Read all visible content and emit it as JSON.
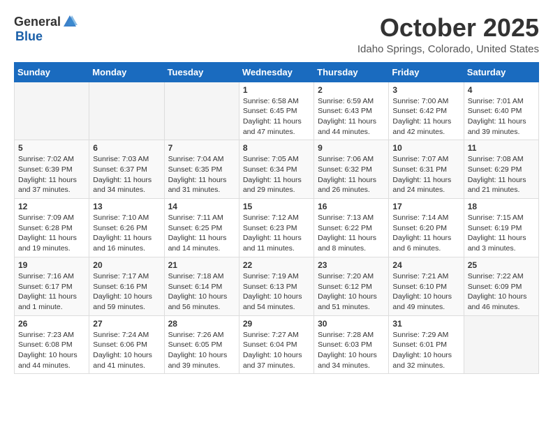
{
  "header": {
    "logo_general": "General",
    "logo_blue": "Blue",
    "title": "October 2025",
    "location": "Idaho Springs, Colorado, United States"
  },
  "columns": [
    "Sunday",
    "Monday",
    "Tuesday",
    "Wednesday",
    "Thursday",
    "Friday",
    "Saturday"
  ],
  "weeks": [
    [
      {
        "day": "",
        "info": ""
      },
      {
        "day": "",
        "info": ""
      },
      {
        "day": "",
        "info": ""
      },
      {
        "day": "1",
        "info": "Sunrise: 6:58 AM\nSunset: 6:45 PM\nDaylight: 11 hours and 47 minutes."
      },
      {
        "day": "2",
        "info": "Sunrise: 6:59 AM\nSunset: 6:43 PM\nDaylight: 11 hours and 44 minutes."
      },
      {
        "day": "3",
        "info": "Sunrise: 7:00 AM\nSunset: 6:42 PM\nDaylight: 11 hours and 42 minutes."
      },
      {
        "day": "4",
        "info": "Sunrise: 7:01 AM\nSunset: 6:40 PM\nDaylight: 11 hours and 39 minutes."
      }
    ],
    [
      {
        "day": "5",
        "info": "Sunrise: 7:02 AM\nSunset: 6:39 PM\nDaylight: 11 hours and 37 minutes."
      },
      {
        "day": "6",
        "info": "Sunrise: 7:03 AM\nSunset: 6:37 PM\nDaylight: 11 hours and 34 minutes."
      },
      {
        "day": "7",
        "info": "Sunrise: 7:04 AM\nSunset: 6:35 PM\nDaylight: 11 hours and 31 minutes."
      },
      {
        "day": "8",
        "info": "Sunrise: 7:05 AM\nSunset: 6:34 PM\nDaylight: 11 hours and 29 minutes."
      },
      {
        "day": "9",
        "info": "Sunrise: 7:06 AM\nSunset: 6:32 PM\nDaylight: 11 hours and 26 minutes."
      },
      {
        "day": "10",
        "info": "Sunrise: 7:07 AM\nSunset: 6:31 PM\nDaylight: 11 hours and 24 minutes."
      },
      {
        "day": "11",
        "info": "Sunrise: 7:08 AM\nSunset: 6:29 PM\nDaylight: 11 hours and 21 minutes."
      }
    ],
    [
      {
        "day": "12",
        "info": "Sunrise: 7:09 AM\nSunset: 6:28 PM\nDaylight: 11 hours and 19 minutes."
      },
      {
        "day": "13",
        "info": "Sunrise: 7:10 AM\nSunset: 6:26 PM\nDaylight: 11 hours and 16 minutes."
      },
      {
        "day": "14",
        "info": "Sunrise: 7:11 AM\nSunset: 6:25 PM\nDaylight: 11 hours and 14 minutes."
      },
      {
        "day": "15",
        "info": "Sunrise: 7:12 AM\nSunset: 6:23 PM\nDaylight: 11 hours and 11 minutes."
      },
      {
        "day": "16",
        "info": "Sunrise: 7:13 AM\nSunset: 6:22 PM\nDaylight: 11 hours and 8 minutes."
      },
      {
        "day": "17",
        "info": "Sunrise: 7:14 AM\nSunset: 6:20 PM\nDaylight: 11 hours and 6 minutes."
      },
      {
        "day": "18",
        "info": "Sunrise: 7:15 AM\nSunset: 6:19 PM\nDaylight: 11 hours and 3 minutes."
      }
    ],
    [
      {
        "day": "19",
        "info": "Sunrise: 7:16 AM\nSunset: 6:17 PM\nDaylight: 11 hours and 1 minute."
      },
      {
        "day": "20",
        "info": "Sunrise: 7:17 AM\nSunset: 6:16 PM\nDaylight: 10 hours and 59 minutes."
      },
      {
        "day": "21",
        "info": "Sunrise: 7:18 AM\nSunset: 6:14 PM\nDaylight: 10 hours and 56 minutes."
      },
      {
        "day": "22",
        "info": "Sunrise: 7:19 AM\nSunset: 6:13 PM\nDaylight: 10 hours and 54 minutes."
      },
      {
        "day": "23",
        "info": "Sunrise: 7:20 AM\nSunset: 6:12 PM\nDaylight: 10 hours and 51 minutes."
      },
      {
        "day": "24",
        "info": "Sunrise: 7:21 AM\nSunset: 6:10 PM\nDaylight: 10 hours and 49 minutes."
      },
      {
        "day": "25",
        "info": "Sunrise: 7:22 AM\nSunset: 6:09 PM\nDaylight: 10 hours and 46 minutes."
      }
    ],
    [
      {
        "day": "26",
        "info": "Sunrise: 7:23 AM\nSunset: 6:08 PM\nDaylight: 10 hours and 44 minutes."
      },
      {
        "day": "27",
        "info": "Sunrise: 7:24 AM\nSunset: 6:06 PM\nDaylight: 10 hours and 41 minutes."
      },
      {
        "day": "28",
        "info": "Sunrise: 7:26 AM\nSunset: 6:05 PM\nDaylight: 10 hours and 39 minutes."
      },
      {
        "day": "29",
        "info": "Sunrise: 7:27 AM\nSunset: 6:04 PM\nDaylight: 10 hours and 37 minutes."
      },
      {
        "day": "30",
        "info": "Sunrise: 7:28 AM\nSunset: 6:03 PM\nDaylight: 10 hours and 34 minutes."
      },
      {
        "day": "31",
        "info": "Sunrise: 7:29 AM\nSunset: 6:01 PM\nDaylight: 10 hours and 32 minutes."
      },
      {
        "day": "",
        "info": ""
      }
    ]
  ]
}
